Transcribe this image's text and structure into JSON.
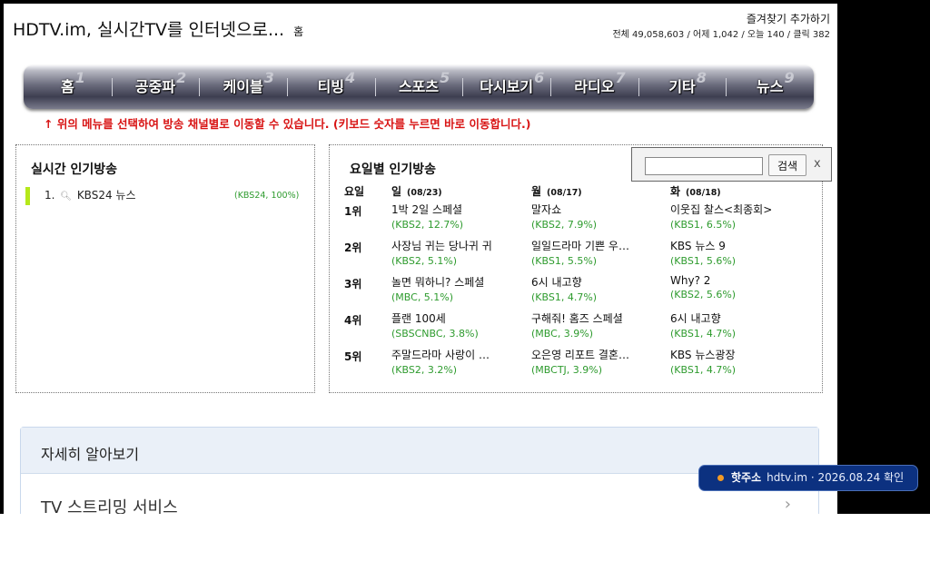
{
  "header": {
    "title": "HDTV.im, 실시간TV를 인터넷으로...",
    "home_link": "홈",
    "favorite_link": "즐겨찾기 추가하기",
    "stats": "전체 49,058,603 / 어제 1,042 / 오늘 140 / 클릭 382"
  },
  "nav": [
    {
      "label": "홈",
      "num": "1"
    },
    {
      "label": "공중파",
      "num": "2"
    },
    {
      "label": "케이블",
      "num": "3"
    },
    {
      "label": "티빙",
      "num": "4"
    },
    {
      "label": "스포츠",
      "num": "5"
    },
    {
      "label": "다시보기",
      "num": "6"
    },
    {
      "label": "라디오",
      "num": "7"
    },
    {
      "label": "기타",
      "num": "8"
    },
    {
      "label": "뉴스",
      "num": "9"
    }
  ],
  "hint": "↑ 위의 메뉴를 선택하여 방송 채널별로 이동할 수 있습니다. (키보드 숫자를 누르면 바로 이동합니다.)",
  "realtime": {
    "title": "실시간 인기방송",
    "items": [
      {
        "rank": "1.",
        "name": "KBS24 뉴스",
        "meta": "(KBS24, 100%)"
      }
    ]
  },
  "weekday": {
    "title": "요일별 인기방송",
    "day_header": "요일",
    "days": [
      {
        "day": "일",
        "date": "(08/23)"
      },
      {
        "day": "월",
        "date": "(08/17)"
      },
      {
        "day": "화",
        "date": "(08/18)"
      }
    ],
    "ranks": [
      "1위",
      "2위",
      "3위",
      "4위",
      "5위"
    ],
    "cells": [
      [
        {
          "prog": "1박 2일 스페셜",
          "meta": "(KBS2, 12.7%)"
        },
        {
          "prog": "말자쇼",
          "meta": "(KBS2, 7.9%)"
        },
        {
          "prog": "이웃집 찰스<최종회>",
          "meta": "(KBS1, 6.5%)"
        }
      ],
      [
        {
          "prog": "사장님 귀는 당나귀 귀",
          "meta": "(KBS2, 5.1%)"
        },
        {
          "prog": "일일드라마 기쁜 우…",
          "meta": "(KBS1, 5.5%)"
        },
        {
          "prog": "KBS 뉴스 9",
          "meta": "(KBS1, 5.6%)"
        }
      ],
      [
        {
          "prog": "놀면 뭐하니? 스페셜",
          "meta": "(MBC, 5.1%)"
        },
        {
          "prog": "6시 내고향",
          "meta": "(KBS1, 4.7%)"
        },
        {
          "prog": "Why? 2",
          "meta": "(KBS2, 5.6%)"
        }
      ],
      [
        {
          "prog": "플랜 100세",
          "meta": "(SBSCNBC, 3.8%)"
        },
        {
          "prog": "구해줘! 홈즈 스페셜",
          "meta": "(MBC, 3.9%)"
        },
        {
          "prog": "6시 내고향",
          "meta": "(KBS1, 4.7%)"
        }
      ],
      [
        {
          "prog": "주말드라마 사랑이 …",
          "meta": "(KBS2, 3.2%)"
        },
        {
          "prog": "오은영 리포트 결혼…",
          "meta": "(MBCTJ, 3.9%)"
        },
        {
          "prog": "KBS 뉴스광장",
          "meta": "(KBS1, 4.7%)"
        }
      ]
    ]
  },
  "search": {
    "placeholder": "",
    "button": "검색",
    "close": "x"
  },
  "more": {
    "title": "자세히 알아보기",
    "link": "TV 스트리밍 서비스",
    "chevron": "›"
  },
  "toast": {
    "label": "핫주소",
    "text": "hdtv.im · 2026.08.24 확인"
  },
  "colors": {
    "hint": "#d81414",
    "meta_green": "#2e9b2e",
    "rank_bar": "#b5e81a",
    "toast_bg": "#0c3180",
    "toast_dot": "#f29a25"
  }
}
